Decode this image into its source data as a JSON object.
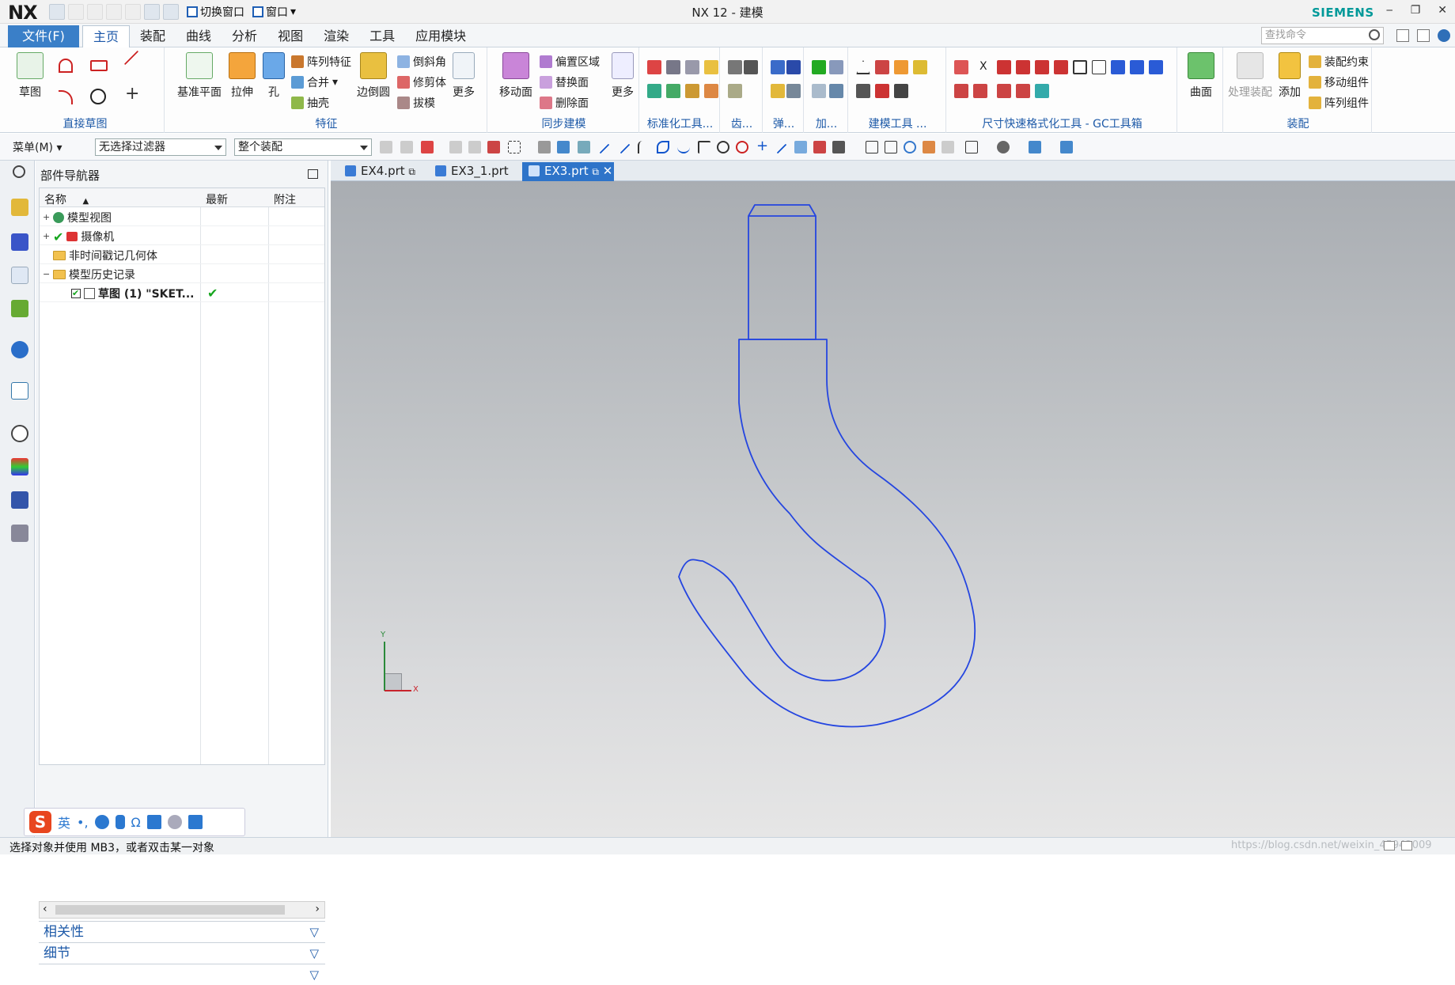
{
  "app": {
    "logo": "NX",
    "title": "NX 12 - 建模",
    "brand": "SIEMENS"
  },
  "qat": {
    "switch_window": "切换窗口",
    "window": "窗口"
  },
  "menubar": {
    "file": "文件(F)",
    "tabs": [
      "主页",
      "装配",
      "曲线",
      "分析",
      "视图",
      "渲染",
      "工具",
      "应用模块"
    ],
    "search_placeholder": "查找命令"
  },
  "ribbon": {
    "sketch": {
      "label": "草图",
      "group": "直接草图"
    },
    "feature": {
      "datum": "基准平面",
      "extrude": "拉伸",
      "hole": "孔",
      "pattern": "阵列特征",
      "unite": "合并",
      "shell": "抽壳",
      "edge_blend": "边倒圆",
      "chamfer": "倒斜角",
      "trim_body": "修剪体",
      "draft": "拔模",
      "more": "更多",
      "group": "特征"
    },
    "sync": {
      "move_face": "移动面",
      "offset_region": "偏置区域",
      "replace_face": "替换面",
      "delete_face": "删除面",
      "more": "更多",
      "group": "同步建模"
    },
    "std": {
      "group": "标准化工具..."
    },
    "gear": {
      "group": "齿..."
    },
    "spring": {
      "group": "弹..."
    },
    "add": {
      "group": "加..."
    },
    "modeling_tools": {
      "group": "建模工具 ..."
    },
    "dim": {
      "group": "尺寸快速格式化工具 - GC工具箱",
      "xlabel": "X"
    },
    "surface": {
      "label": "曲面"
    },
    "assembly": {
      "process": "处理装配",
      "add": "添加",
      "constraint": "装配约束",
      "move": "移动组件",
      "pattern": "阵列组件",
      "group": "装配"
    }
  },
  "toolbar2": {
    "menu": "菜单(M)",
    "filter": "无选择过滤器",
    "scope": "整个装配"
  },
  "navigator": {
    "title": "部件导航器",
    "columns": [
      "名称",
      "最新",
      "附注"
    ],
    "rows": [
      {
        "label": "模型视图",
        "toggle": "+"
      },
      {
        "label": "摄像机",
        "toggle": "+"
      },
      {
        "label": "非时间戳记几何体",
        "toggle": ""
      },
      {
        "label": "模型历史记录",
        "toggle": "−"
      },
      {
        "label": "草图 (1) \"SKET...",
        "toggle": "",
        "latest": "✔"
      }
    ],
    "sections": [
      "相关性",
      "细节"
    ]
  },
  "ime": {
    "lang": "英"
  },
  "doc_tabs": [
    "EX4.prt",
    "EX3_1.prt",
    "EX3.prt"
  ],
  "axes": {
    "x": "X",
    "y": "Y"
  },
  "status": {
    "text": "选择对象并使用 MB3，或者双击某一对象",
    "watermark": "https://blog.csdn.net/weixin_45942009"
  },
  "colors": {
    "accent": "#2e74c9",
    "curve": "#2546e0",
    "brand": "#009999"
  }
}
